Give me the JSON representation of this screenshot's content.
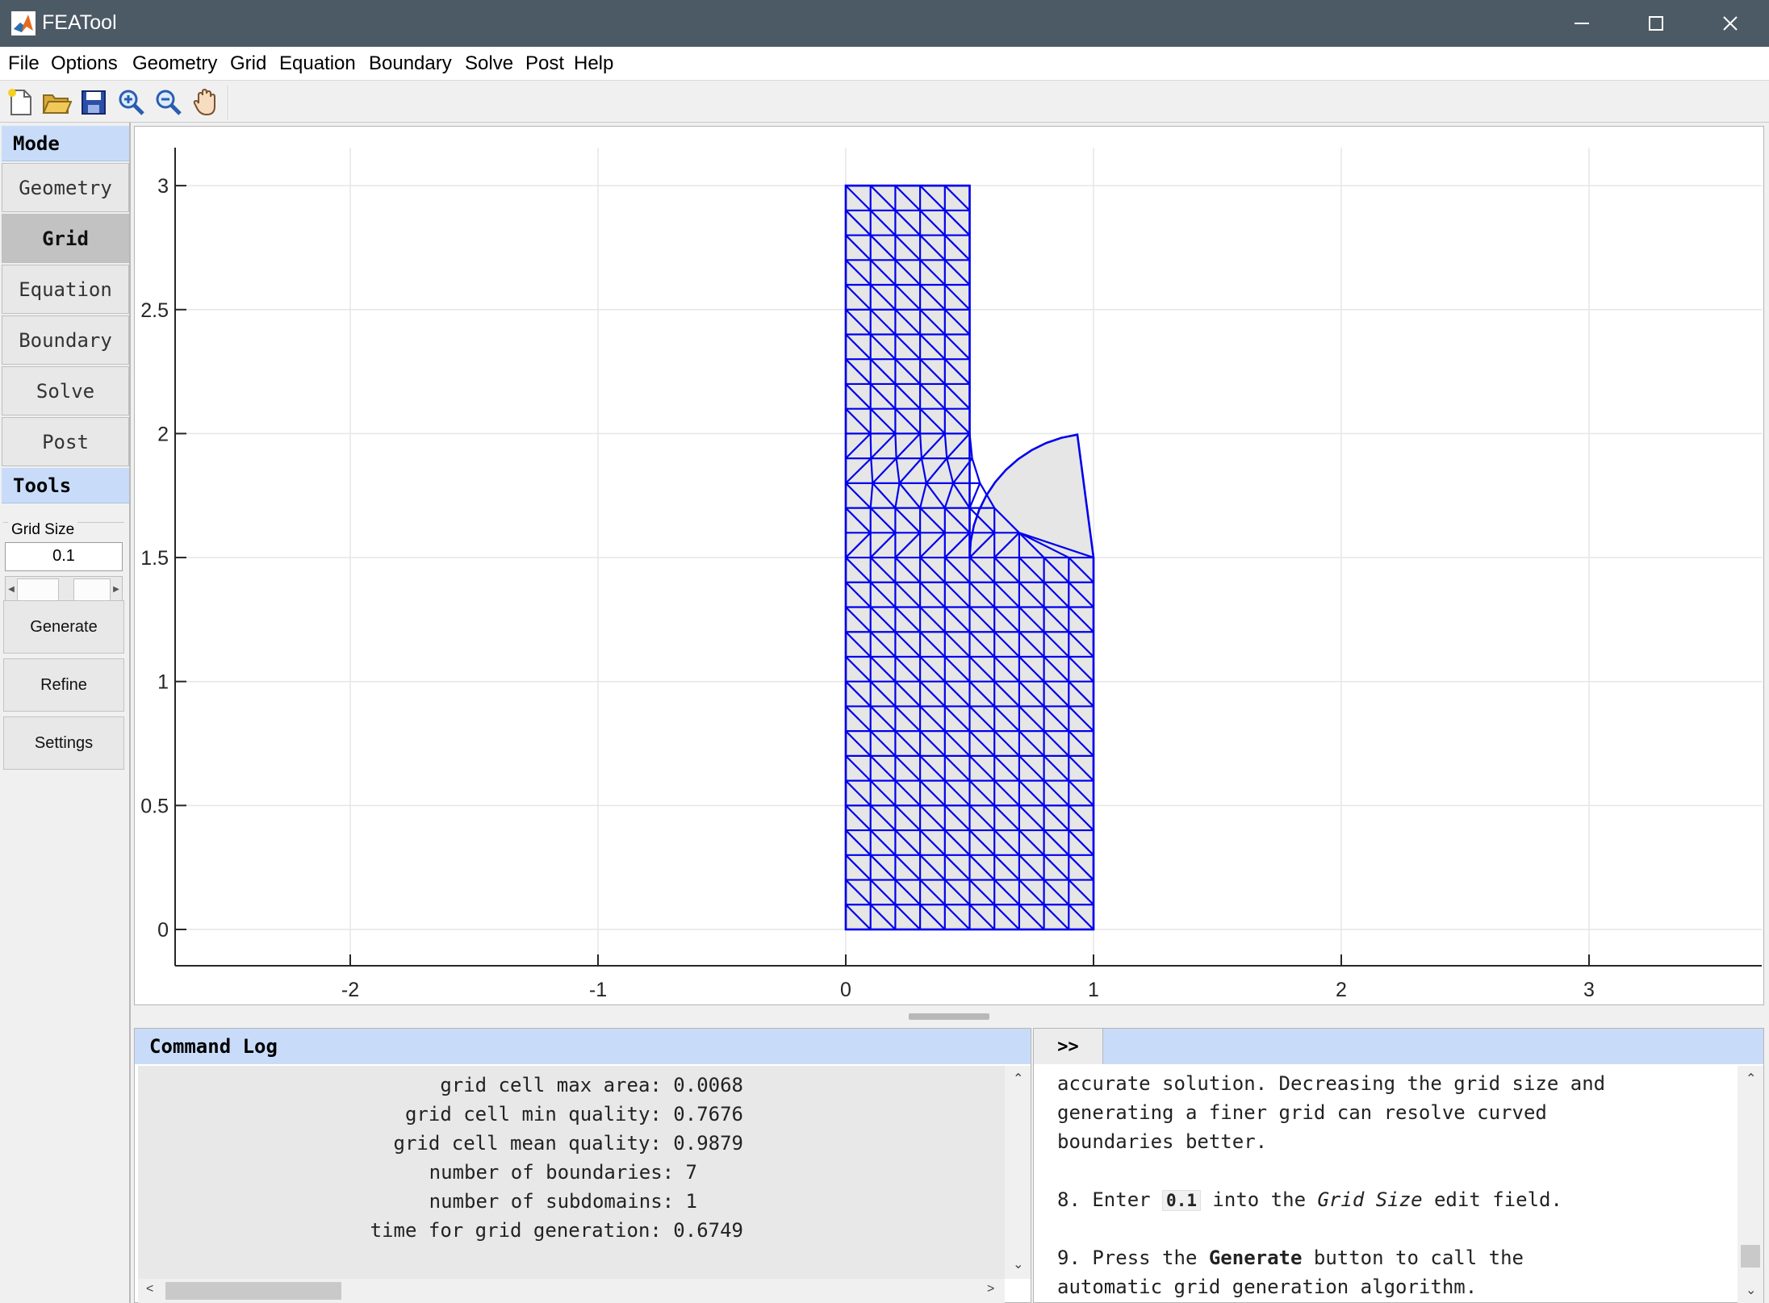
{
  "window": {
    "title": "FEATool"
  },
  "menu": [
    "File",
    "Options",
    "Geometry",
    "Grid",
    "Equation",
    "Boundary",
    "Solve",
    "Post",
    "Help"
  ],
  "toolbar": [
    "new-file-icon",
    "open-folder-icon",
    "save-icon",
    "zoom-in-icon",
    "zoom-out-icon",
    "pan-hand-icon"
  ],
  "sidebar": {
    "mode_header": "Mode",
    "modes": [
      "Geometry",
      "Grid",
      "Equation",
      "Boundary",
      "Solve",
      "Post"
    ],
    "active_mode": "Grid",
    "tools_header": "Tools",
    "grid_size_label": "Grid Size",
    "grid_size_value": "0.1",
    "buttons": [
      "Generate",
      "Refine",
      "Settings"
    ]
  },
  "plot": {
    "x_ticks": [
      "-2",
      "-1",
      "0",
      "1",
      "2",
      "3"
    ],
    "y_ticks": [
      "0",
      "0.5",
      "1",
      "1.5",
      "2",
      "2.5",
      "3"
    ],
    "mesh_color": "#0000ee",
    "fill_color": "#e6e6e6"
  },
  "log": {
    "title": "Command Log",
    "lines": [
      "grid cell max area: 0.0068",
      "grid cell min quality: 0.7676",
      "grid cell mean quality: 0.9879",
      "number of boundaries: 7",
      "number of subdomains: 1",
      "time for grid generation: 0.6749"
    ]
  },
  "help": {
    "toggle": ">>",
    "line1": "accurate solution. Decreasing the grid size and",
    "line2": "generating a finer grid can resolve curved",
    "line3": "boundaries better.",
    "step8_prefix": "8. Enter ",
    "step8_code": "0.1",
    "step8_mid": " into the ",
    "step8_em": "Grid Size",
    "step8_suffix": " edit field.",
    "step9_prefix": "9. Press the ",
    "step9_bold": "Generate",
    "step9_suffix": " button to call the",
    "line_last": "automatic grid generation algorithm."
  }
}
